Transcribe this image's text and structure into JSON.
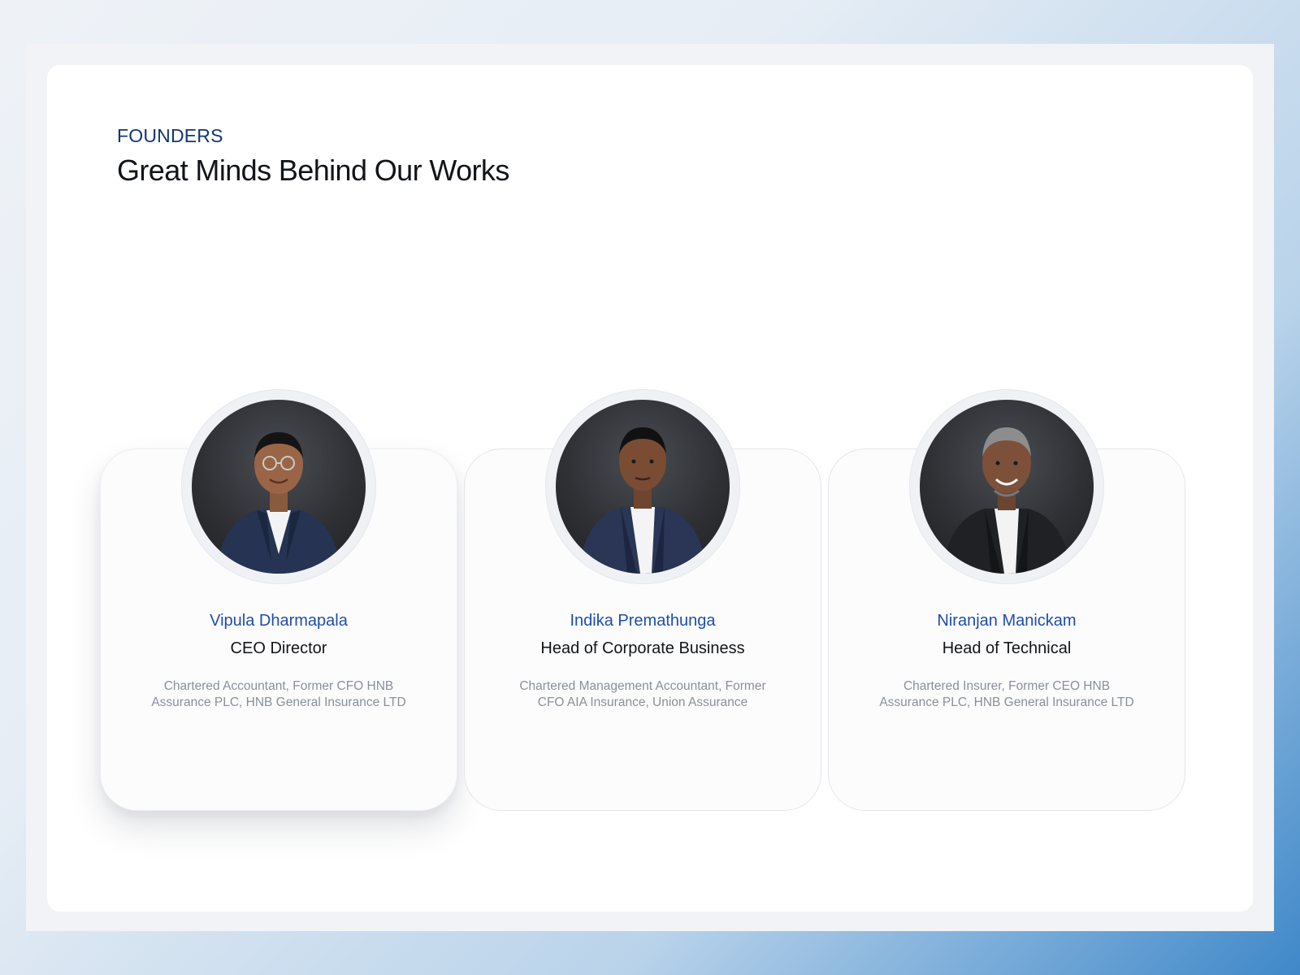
{
  "section": {
    "eyebrow": "FOUNDERS",
    "heading": "Great Minds Behind Our Works"
  },
  "founders": [
    {
      "name": "Vipula Dharmapala",
      "role": "CEO Director",
      "bio": "Chartered Accountant, Former CFO HNB Assurance PLC, HNB General Insurance LTD",
      "featured": true
    },
    {
      "name": "Indika Premathunga",
      "role": "Head of Corporate Business",
      "bio": "Chartered Management Accountant, Former CFO AIA Insurance, Union Assurance",
      "featured": false
    },
    {
      "name": "Niranjan Manickam",
      "role": "Head of Technical",
      "bio": "Chartered Insurer, Former CEO HNB Assurance PLC, HNB General Insurance LTD",
      "featured": false
    }
  ],
  "colors": {
    "accent": "#1f4ea8",
    "eyebrow": "#14366f",
    "heading": "#111418",
    "muted": "#8a8f98"
  }
}
